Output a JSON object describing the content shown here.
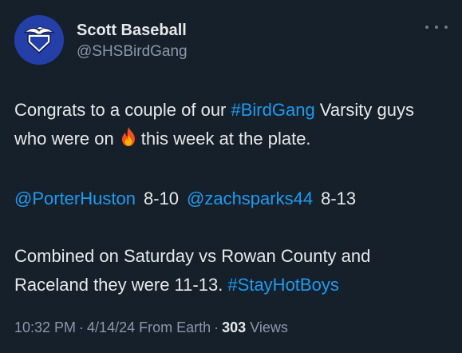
{
  "author": {
    "name": "Scott Baseball",
    "handle": "@SHSBirdGang",
    "avatar_icon": "eagle-home-plate-logo"
  },
  "tweet": {
    "line1_text_a": "Congrats to a couple of our ",
    "line1_hashtag": "#BirdGang",
    "line1_text_b": " Varsity guys who were on",
    "fire_icon": "fire-emoji",
    "line1_text_c": "this week at the plate.",
    "mention_1": "@PorterHuston",
    "stat_1": "8-10",
    "mention_2": "@zachsparks44",
    "stat_2": "8-13",
    "line3_text": "Combined on Saturday vs Rowan County and Raceland they were 11-13. ",
    "line3_hashtag": "#StayHotBoys"
  },
  "meta": {
    "time": "10:32 PM",
    "date": "4/14/24",
    "source": "From Earth",
    "views_count": "303",
    "views_label": "Views",
    "separator": "·"
  },
  "colors": {
    "background": "#15202b",
    "text": "#e7e9ea",
    "secondary": "#8b98a5",
    "link": "#1d9bf0",
    "avatar_bg": "#243fa8"
  },
  "more_icon": "more-horizontal-icon"
}
